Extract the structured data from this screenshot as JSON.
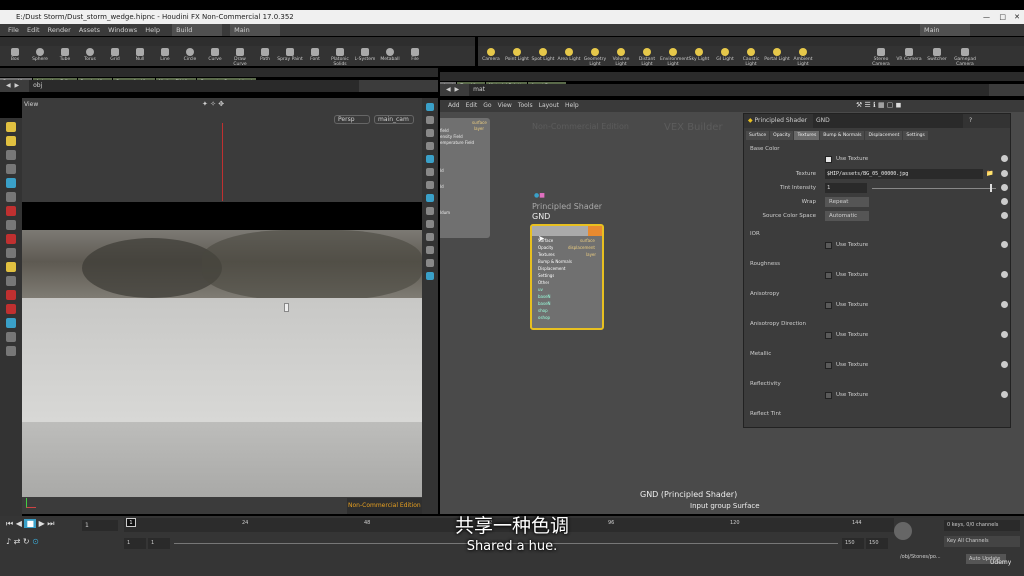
{
  "window": {
    "title": "E:/Dust Storm/Dust_storm_wedge.hipnc - Houdini FX Non-Commercial 17.0.352"
  },
  "menu": [
    "File",
    "Edit",
    "Render",
    "Assets",
    "Windows",
    "Help"
  ],
  "desktop": {
    "build": "Build",
    "main_left": "Main",
    "main_right": "Main"
  },
  "shelf_left": {
    "tabs": [
      "Create",
      "Modify",
      "Model",
      "Polygon",
      "Deform",
      "Texture",
      "Rigging",
      "Muscles",
      "Characters",
      "Constraints",
      "Hair Utils",
      "Guide Process",
      "Terrain FX",
      "Simple FX",
      "Cloud FX",
      "Volume"
    ],
    "tools": [
      "Box",
      "Sphere",
      "Tube",
      "Torus",
      "Grid",
      "Null",
      "Line",
      "Circle",
      "Curve",
      "Draw Curve",
      "Path",
      "Spray Paint",
      "Font",
      "Platonic Solids",
      "L-System",
      "Metaball",
      "File"
    ]
  },
  "shelf_right": {
    "tabs": [
      "Lights and C.",
      "Collisions",
      "Particles",
      "Grains",
      "Vellum",
      "Rigid Bodies",
      "Particle Fluids",
      "Viscous Fluids",
      "Oceans",
      "Fluid Contai.",
      "Populate Con.",
      "Container Tools",
      "Pyro FX",
      "FEM",
      "Wires",
      "Crowds",
      "Drive Simula."
    ],
    "tools": [
      "Camera",
      "Point Light",
      "Spot Light",
      "Area Light",
      "Geometry Light",
      "Volume Light",
      "Distant Light",
      "Environment Light",
      "Sky Light",
      "GI Light",
      "Caustic Light",
      "Portal Light",
      "Ambient Light",
      "Stereo Camera",
      "VR Camera",
      "Switcher",
      "Gamepad Camera"
    ]
  },
  "left_panes": {
    "tabs": [
      "Scene View",
      "Animation Editor",
      "Render View",
      "Composite View",
      "Motion FX View",
      "Geometry Spreadsheet"
    ],
    "path": "obj",
    "view_label": "View",
    "camera_mode": "Persp",
    "camera": "main_cam",
    "watermark": "Non-Commercial Edition"
  },
  "right_panes": {
    "tabs": [
      "/mat",
      "Tree View",
      "Material Palette",
      "Asset Browser"
    ],
    "path": "mat",
    "menu": [
      "Add",
      "Edit",
      "Go",
      "View",
      "Tools",
      "Layout",
      "Help"
    ],
    "watermark": "Non-Commercial Edition",
    "context": "VEX Builder"
  },
  "side_node": {
    "outputs": [
      "surface",
      "layer"
    ],
    "labels": [
      "field",
      "ensity Field",
      "emperature Field",
      "ld",
      "ld",
      "ldum"
    ]
  },
  "node": {
    "type": "Principled Shader",
    "name": "GND",
    "inputs": [
      "Surface",
      "Opacity",
      "Textures",
      "Bump & Normals",
      "Displacement",
      "Settings",
      "Other",
      "uv",
      "baseN",
      "baseN",
      "shop",
      "oshop"
    ],
    "outputs": [
      "surface",
      "displacement",
      "layer"
    ]
  },
  "node_caption": {
    "line1": "GND (Principled Shader)",
    "line2": "Input group Surface"
  },
  "params": {
    "type": "Principled Shader",
    "name": "GND",
    "tabs": [
      "Surface",
      "Opacity",
      "Textures",
      "Bump & Normals",
      "Displacement",
      "Settings"
    ],
    "active_tab": "Textures",
    "base_color": "Base Color",
    "use_texture": "Use Texture",
    "texture_label": "Texture",
    "texture_value": "$HIP/assets/BG_05_00000.jpg",
    "tint_label": "Tint Intensity",
    "tint_value": "1",
    "tint_fraction": 0.95,
    "wrap_label": "Wrap",
    "wrap_value": "Repeat",
    "colorspace_label": "Source Color Space",
    "colorspace_value": "Automatic",
    "sections": [
      "IOR",
      "Roughness",
      "Anisotropy",
      "Anisotropy Direction",
      "Metallic",
      "Reflectivity",
      "Reflect Tint"
    ]
  },
  "timeline": {
    "current_frame": "1",
    "start": "1",
    "start2": "1",
    "ticks": [
      "24",
      "48",
      "72",
      "96",
      "120",
      "144"
    ],
    "end1": "150",
    "end2": "150",
    "keys": "0 keys, 0/0 channels",
    "key_all": "Key All Channels",
    "path": "/obj/Stones/po...",
    "update": "Auto Update",
    "brand": "Udemy"
  },
  "subtitle": {
    "cn": "共享一种色调",
    "en": "Shared a hue."
  }
}
